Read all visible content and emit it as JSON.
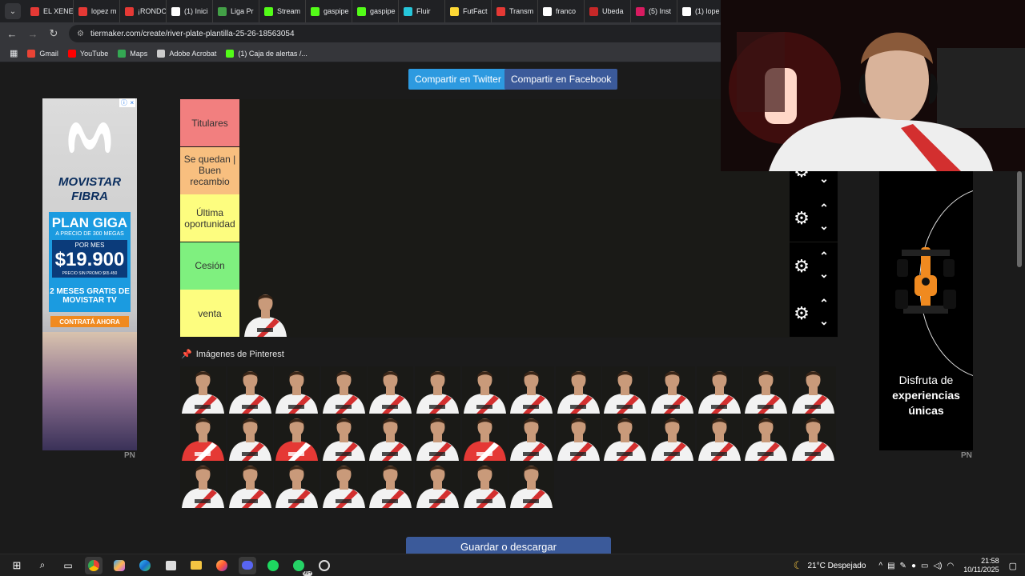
{
  "browser": {
    "tabs": [
      {
        "label": "EL XENE",
        "color": "#e53935"
      },
      {
        "label": "lopez m",
        "color": "#e53935"
      },
      {
        "label": "¡RONDO",
        "color": "#e53935"
      },
      {
        "label": "(1) Inici",
        "color": "#ffffff"
      },
      {
        "label": "Liga Pr",
        "color": "#43a047"
      },
      {
        "label": "Stream",
        "color": "#53fc18"
      },
      {
        "label": "gaspipe",
        "color": "#53fc18"
      },
      {
        "label": "gaspipe",
        "color": "#53fc18"
      },
      {
        "label": "Fluir",
        "color": "#26c6da"
      },
      {
        "label": "FutFact",
        "color": "#fdd835"
      },
      {
        "label": "Transm",
        "color": "#e53935"
      },
      {
        "label": "franco",
        "color": "#ffffff"
      },
      {
        "label": "Ubeda",
        "color": "#c62828"
      },
      {
        "label": "(5) Inst",
        "color": "#d81b60"
      },
      {
        "label": "(1) lope",
        "color": "#ffffff"
      }
    ],
    "url": "tiermaker.com/create/river-plate-plantilla-25-26-18563054",
    "bookmarks": [
      {
        "label": "Gmail",
        "color": "#ea4335"
      },
      {
        "label": "YouTube",
        "color": "#ff0000"
      },
      {
        "label": "Maps",
        "color": "#34a853"
      },
      {
        "label": "Adobe Acrobat",
        "color": "#cccccc"
      },
      {
        "label": "(1) Caja de alertas /...",
        "color": "#53fc18"
      }
    ]
  },
  "share": {
    "twitter": "Compartir en Twitter",
    "facebook": "Compartir en Facebook"
  },
  "ad_left": {
    "brand_line1": "MOVISTAR",
    "brand_line2": "FIBRA",
    "plan": "PLAN GIGA",
    "plan_sub": "A PRECIO DE 300 MEGAS",
    "per_month": "POR MES",
    "price": "$19.900",
    "price_note": "PRECIO SIN PROMO $65.450",
    "months": "2 MESES GRATIS DE MOVISTAR TV",
    "cta": "CONTRATÁ AHORA",
    "pn": "PN"
  },
  "ad_right": {
    "line1": "Disfruta de",
    "line2": "experiencias",
    "line3": "únicas",
    "pn": "PN"
  },
  "tiers": [
    {
      "label": "Titulares",
      "color": "#f27f7f"
    },
    {
      "label": "Se quedan | Buen recambio",
      "color": "#f8bf7f"
    },
    {
      "label": "Última oportunidad",
      "color": "#fdfd7f"
    },
    {
      "label": "Cesión",
      "color": "#7ff07f"
    },
    {
      "label": "venta",
      "color": "#fdfd7f"
    }
  ],
  "icons": {
    "gear": "gear-icon",
    "up": "chevron-up-icon",
    "down": "chevron-down-icon",
    "pin": "pushpin-icon"
  },
  "pool_title": "Imágenes de Pinterest",
  "save_button": "Guardar o descargar",
  "taskbar": {
    "weather": "21°C  Despejado",
    "time": "21:58",
    "date": "10/11/2025",
    "badge": "99+"
  }
}
